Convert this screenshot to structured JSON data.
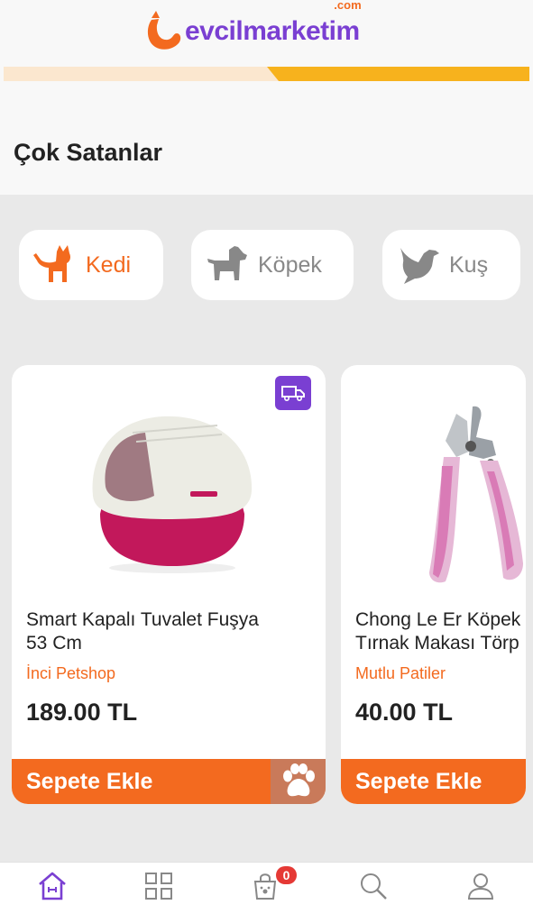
{
  "brand": {
    "name": "evcilmarketim",
    "suffix": ".com",
    "primary_color": "#f36a1f",
    "accent_color": "#7a3fd2"
  },
  "section": {
    "title": "Çok Satanlar"
  },
  "categories": [
    {
      "label": "Kedi",
      "icon": "cat-icon",
      "active": true
    },
    {
      "label": "Köpek",
      "icon": "dog-icon",
      "active": false
    },
    {
      "label": "Kuş",
      "icon": "bird-icon",
      "active": false
    }
  ],
  "products": [
    {
      "name": "Smart Kapalı Tuvalet Fuşya\n53 Cm",
      "shop": "İnci Petshop",
      "price": "189.00 TL",
      "button_label": "Sepete Ekle",
      "badge_icon": "truck-icon"
    },
    {
      "name": "Chong Le Er Köpek\nTırnak Makası Törp",
      "shop": "Mutlu Patiler",
      "price": "40.00 TL",
      "button_label": "Sepete Ekle"
    }
  ],
  "bottom_nav": {
    "items": [
      {
        "name": "home",
        "icon": "home-icon",
        "active": true
      },
      {
        "name": "categories",
        "icon": "grid-icon",
        "active": false
      },
      {
        "name": "cart",
        "icon": "cart-icon",
        "active": false
      },
      {
        "name": "search",
        "icon": "search-icon",
        "active": false
      },
      {
        "name": "profile",
        "icon": "user-icon",
        "active": false
      }
    ],
    "cart_count": "0"
  }
}
